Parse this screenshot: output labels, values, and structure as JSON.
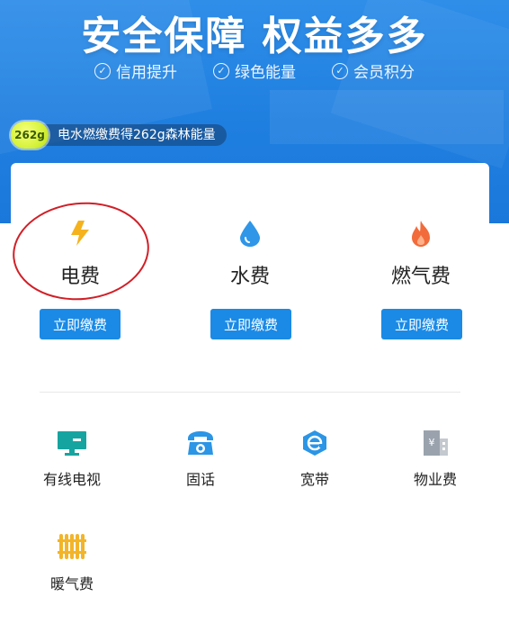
{
  "banner": {
    "headline": "安全保障 权益多多",
    "features": [
      "信用提升",
      "绿色能量",
      "会员积分"
    ],
    "energy_badge": "262g",
    "energy_text": "电水燃缴费得262g森林能量"
  },
  "utilities": [
    {
      "name": "电费",
      "icon": "lightning-icon",
      "button": "立即缴费",
      "color": "#f5b21c"
    },
    {
      "name": "水费",
      "icon": "water-drop-icon",
      "button": "立即缴费",
      "color": "#2f96e8"
    },
    {
      "name": "燃气费",
      "icon": "flame-icon",
      "button": "立即缴费",
      "color": "#f26b3a"
    }
  ],
  "services": [
    {
      "name": "有线电视",
      "icon": "tv-monitor-icon",
      "color": "#16a4a0"
    },
    {
      "name": "固话",
      "icon": "telephone-icon",
      "color": "#2b95e6"
    },
    {
      "name": "宽带",
      "icon": "broadband-icon",
      "color": "#2b95e6"
    },
    {
      "name": "物业费",
      "icon": "building-icon",
      "color": "#9aa3ad"
    },
    {
      "name": "暖气费",
      "icon": "radiator-icon",
      "color": "#f2b52a"
    }
  ]
}
